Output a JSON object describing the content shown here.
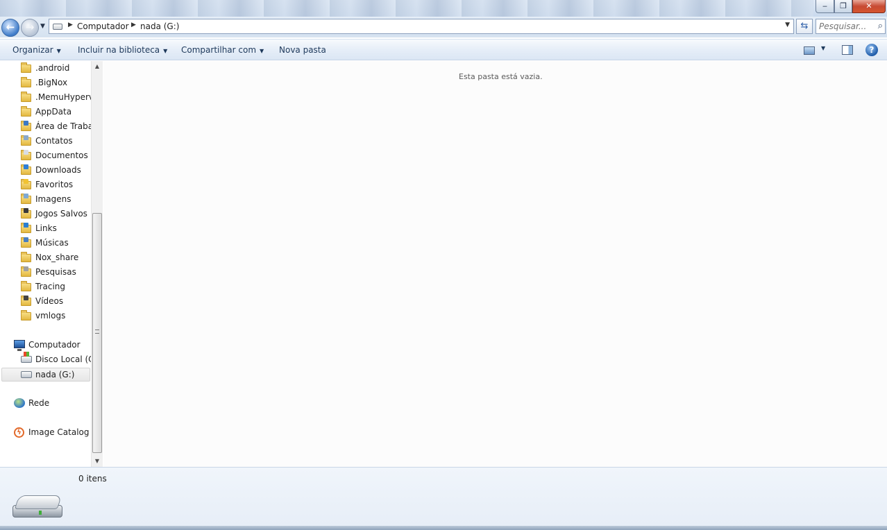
{
  "window": {
    "minimize": "‒",
    "maximize": "❐",
    "close": "✕"
  },
  "address": {
    "crumbs": [
      "Computador",
      "nada (G:)"
    ]
  },
  "search": {
    "placeholder": "Pesquisar..."
  },
  "toolbar": {
    "organize": "Organizar",
    "include_library": "Incluir na biblioteca",
    "share_with": "Compartilhar com",
    "new_folder": "Nova pasta",
    "help": "?"
  },
  "nav": {
    "folders": [
      {
        "label": ".android",
        "overlay": ""
      },
      {
        "label": ".BigNox",
        "overlay": ""
      },
      {
        "label": ".MemuHyperv",
        "overlay": ""
      },
      {
        "label": "AppData",
        "overlay": ""
      },
      {
        "label": "Área de Trabalho",
        "overlay": "#3b78c4"
      },
      {
        "label": "Contatos",
        "overlay": "#8aa8c8"
      },
      {
        "label": "Documentos",
        "overlay": "#d9dde4"
      },
      {
        "label": "Downloads",
        "overlay": "#2f7fd6"
      },
      {
        "label": "Favoritos",
        "overlay": "#f1c232"
      },
      {
        "label": "Imagens",
        "overlay": "#7fa9d3"
      },
      {
        "label": "Jogos Salvos",
        "overlay": "#3a3a3a"
      },
      {
        "label": "Links",
        "overlay": "#2a7ed3"
      },
      {
        "label": "Músicas",
        "overlay": "#4a7fc0"
      },
      {
        "label": "Nox_share",
        "overlay": ""
      },
      {
        "label": "Pesquisas",
        "overlay": "#a0a0a0"
      },
      {
        "label": "Tracing",
        "overlay": ""
      },
      {
        "label": "Vídeos",
        "overlay": "#444"
      },
      {
        "label": "vmlogs",
        "overlay": ""
      }
    ],
    "computer": "Computador",
    "local_disk": "Disco Local (C:)",
    "selected_drive": "nada (G:)",
    "network": "Rede",
    "image_catalog": "Image Catalog"
  },
  "main": {
    "empty_message": "Esta pasta está vazia."
  },
  "details": {
    "item_count": "0 itens"
  }
}
